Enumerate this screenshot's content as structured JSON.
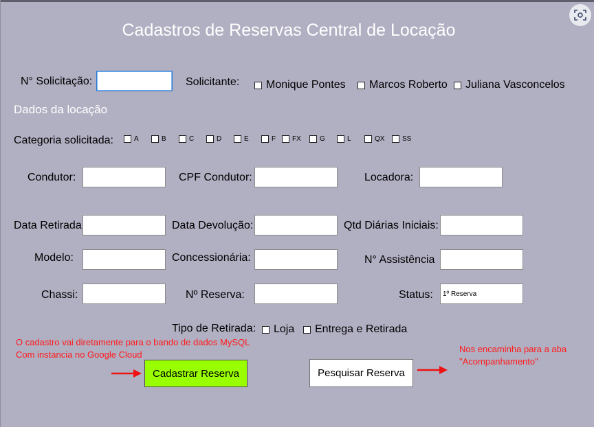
{
  "title": "Cadastros de Reservas Central de Locação",
  "solicitacao": {
    "label": "N° Solicitação:",
    "value": ""
  },
  "solicitante": {
    "label": "Solicitante:",
    "options": [
      "Monique Pontes",
      "Marcos Roberto",
      "Juliana Vasconcelos"
    ]
  },
  "section_title": "Dados da locação",
  "categoria": {
    "label": "Categoria solicitada:",
    "options": [
      "A",
      "B",
      "C",
      "D",
      "E",
      "F",
      "FX",
      "G",
      "L",
      "QX",
      "SS"
    ]
  },
  "fields": {
    "condutor": {
      "label": "Condutor:",
      "value": ""
    },
    "cpf_condutor": {
      "label": "CPF Condutor:",
      "value": ""
    },
    "locadora": {
      "label": "Locadora:",
      "value": ""
    },
    "data_retirada": {
      "label": "Data Retirada:",
      "value": ""
    },
    "data_devolucao": {
      "label": "Data Devolução:",
      "value": ""
    },
    "qtd_diarias": {
      "label": "Qtd Diárias Iniciais:",
      "value": ""
    },
    "modelo": {
      "label": "Modelo:",
      "value": ""
    },
    "concessionaria": {
      "label": "Concessionária:",
      "value": ""
    },
    "assistencia": {
      "label": "N° Assistência",
      "value": ""
    },
    "chassi": {
      "label": "Chassi:",
      "value": ""
    },
    "reserva": {
      "label": "Nº Reserva:",
      "value": ""
    },
    "status": {
      "label": "Status:",
      "value": "1º Reserva"
    }
  },
  "tipo_retirada": {
    "label": "Tipo de Retirada:",
    "options": [
      "Loja",
      "Entrega e Retirada"
    ]
  },
  "buttons": {
    "cadastrar": "Cadastrar Reserva",
    "pesquisar": "Pesquisar Reserva"
  },
  "notes": {
    "left": "O cadastro vai diretamente para o bando de dados MySQL\nCom instancia no Google Cloud",
    "right": "Nos encaminha para a aba\n\"Acompanhamento\""
  },
  "colors": {
    "background": "#b1afc2",
    "title_text": "#ffffff",
    "cadastrar_button": "#99ff00",
    "note_text": "#ff1a1a"
  },
  "icons": {
    "scan": "screenshot-scan-icon",
    "arrow": "red-arrow-icon"
  }
}
